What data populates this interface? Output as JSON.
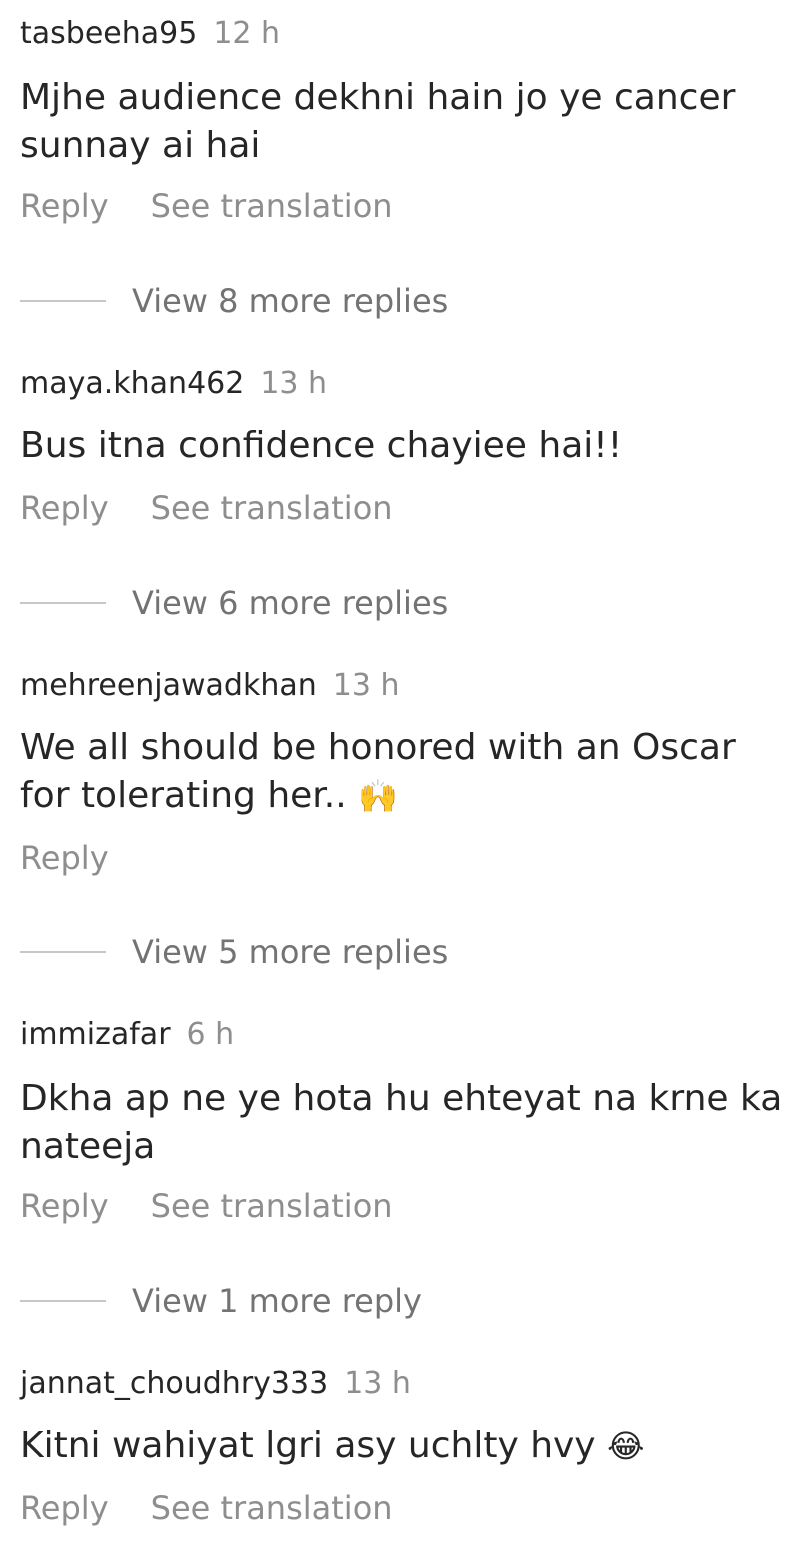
{
  "comments": [
    {
      "username": "tasbeeha95",
      "time": "12 h",
      "text": "Mjhe audience  dekhni hain jo ye cancer sunnay ai hai",
      "emoji": "",
      "reply_label": "Reply",
      "translation_label": "See translation",
      "view_replies_label": "View 8 more replies"
    },
    {
      "username": "maya.khan462",
      "time": "13 h",
      "text": "Bus itna confidence chayiee hai!!",
      "emoji": "",
      "reply_label": "Reply",
      "translation_label": "See translation",
      "view_replies_label": "View 6 more replies"
    },
    {
      "username": "mehreenjawadkhan",
      "time": "13 h",
      "text": "We all should be honored with an Oscar for tolerating her.. ",
      "emoji": "🙌",
      "reply_label": "Reply",
      "translation_label": "",
      "view_replies_label": "View 5 more replies"
    },
    {
      "username": "immizafar",
      "time": "6 h",
      "text": "Dkha ap ne ye hota hu ehteyat na krne ka nateeja",
      "emoji": "",
      "reply_label": "Reply",
      "translation_label": "See translation",
      "view_replies_label": "View 1 more reply"
    },
    {
      "username": "jannat_choudhry333",
      "time": "13 h",
      "text": "Kitni wahiyat lgri asy uchlty hvy ",
      "emoji": "😂",
      "reply_label": "Reply",
      "translation_label": "See translation",
      "view_replies_label": ""
    }
  ],
  "colors": {
    "primary_text": "#262626",
    "secondary_text": "#8e8e8e",
    "divider": "#c7c7c7"
  }
}
